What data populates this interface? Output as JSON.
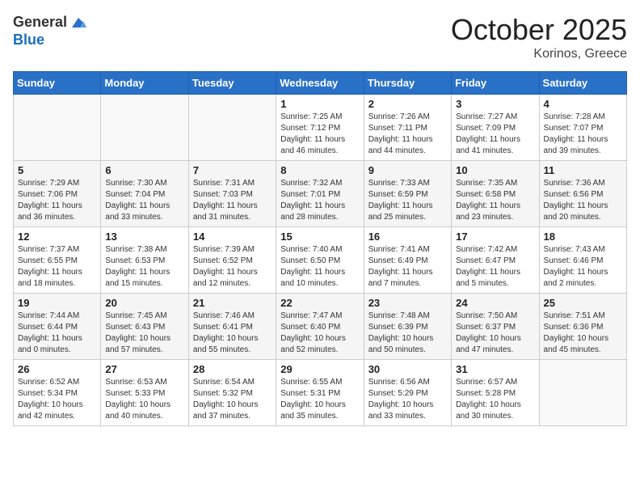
{
  "header": {
    "logo_general": "General",
    "logo_blue": "Blue",
    "month": "October 2025",
    "location": "Korinos, Greece"
  },
  "weekdays": [
    "Sunday",
    "Monday",
    "Tuesday",
    "Wednesday",
    "Thursday",
    "Friday",
    "Saturday"
  ],
  "weeks": [
    [
      {
        "day": "",
        "info": ""
      },
      {
        "day": "",
        "info": ""
      },
      {
        "day": "",
        "info": ""
      },
      {
        "day": "1",
        "info": "Sunrise: 7:25 AM\nSunset: 7:12 PM\nDaylight: 11 hours and 46 minutes."
      },
      {
        "day": "2",
        "info": "Sunrise: 7:26 AM\nSunset: 7:11 PM\nDaylight: 11 hours and 44 minutes."
      },
      {
        "day": "3",
        "info": "Sunrise: 7:27 AM\nSunset: 7:09 PM\nDaylight: 11 hours and 41 minutes."
      },
      {
        "day": "4",
        "info": "Sunrise: 7:28 AM\nSunset: 7:07 PM\nDaylight: 11 hours and 39 minutes."
      }
    ],
    [
      {
        "day": "5",
        "info": "Sunrise: 7:29 AM\nSunset: 7:06 PM\nDaylight: 11 hours and 36 minutes."
      },
      {
        "day": "6",
        "info": "Sunrise: 7:30 AM\nSunset: 7:04 PM\nDaylight: 11 hours and 33 minutes."
      },
      {
        "day": "7",
        "info": "Sunrise: 7:31 AM\nSunset: 7:03 PM\nDaylight: 11 hours and 31 minutes."
      },
      {
        "day": "8",
        "info": "Sunrise: 7:32 AM\nSunset: 7:01 PM\nDaylight: 11 hours and 28 minutes."
      },
      {
        "day": "9",
        "info": "Sunrise: 7:33 AM\nSunset: 6:59 PM\nDaylight: 11 hours and 25 minutes."
      },
      {
        "day": "10",
        "info": "Sunrise: 7:35 AM\nSunset: 6:58 PM\nDaylight: 11 hours and 23 minutes."
      },
      {
        "day": "11",
        "info": "Sunrise: 7:36 AM\nSunset: 6:56 PM\nDaylight: 11 hours and 20 minutes."
      }
    ],
    [
      {
        "day": "12",
        "info": "Sunrise: 7:37 AM\nSunset: 6:55 PM\nDaylight: 11 hours and 18 minutes."
      },
      {
        "day": "13",
        "info": "Sunrise: 7:38 AM\nSunset: 6:53 PM\nDaylight: 11 hours and 15 minutes."
      },
      {
        "day": "14",
        "info": "Sunrise: 7:39 AM\nSunset: 6:52 PM\nDaylight: 11 hours and 12 minutes."
      },
      {
        "day": "15",
        "info": "Sunrise: 7:40 AM\nSunset: 6:50 PM\nDaylight: 11 hours and 10 minutes."
      },
      {
        "day": "16",
        "info": "Sunrise: 7:41 AM\nSunset: 6:49 PM\nDaylight: 11 hours and 7 minutes."
      },
      {
        "day": "17",
        "info": "Sunrise: 7:42 AM\nSunset: 6:47 PM\nDaylight: 11 hours and 5 minutes."
      },
      {
        "day": "18",
        "info": "Sunrise: 7:43 AM\nSunset: 6:46 PM\nDaylight: 11 hours and 2 minutes."
      }
    ],
    [
      {
        "day": "19",
        "info": "Sunrise: 7:44 AM\nSunset: 6:44 PM\nDaylight: 11 hours and 0 minutes."
      },
      {
        "day": "20",
        "info": "Sunrise: 7:45 AM\nSunset: 6:43 PM\nDaylight: 10 hours and 57 minutes."
      },
      {
        "day": "21",
        "info": "Sunrise: 7:46 AM\nSunset: 6:41 PM\nDaylight: 10 hours and 55 minutes."
      },
      {
        "day": "22",
        "info": "Sunrise: 7:47 AM\nSunset: 6:40 PM\nDaylight: 10 hours and 52 minutes."
      },
      {
        "day": "23",
        "info": "Sunrise: 7:48 AM\nSunset: 6:39 PM\nDaylight: 10 hours and 50 minutes."
      },
      {
        "day": "24",
        "info": "Sunrise: 7:50 AM\nSunset: 6:37 PM\nDaylight: 10 hours and 47 minutes."
      },
      {
        "day": "25",
        "info": "Sunrise: 7:51 AM\nSunset: 6:36 PM\nDaylight: 10 hours and 45 minutes."
      }
    ],
    [
      {
        "day": "26",
        "info": "Sunrise: 6:52 AM\nSunset: 5:34 PM\nDaylight: 10 hours and 42 minutes."
      },
      {
        "day": "27",
        "info": "Sunrise: 6:53 AM\nSunset: 5:33 PM\nDaylight: 10 hours and 40 minutes."
      },
      {
        "day": "28",
        "info": "Sunrise: 6:54 AM\nSunset: 5:32 PM\nDaylight: 10 hours and 37 minutes."
      },
      {
        "day": "29",
        "info": "Sunrise: 6:55 AM\nSunset: 5:31 PM\nDaylight: 10 hours and 35 minutes."
      },
      {
        "day": "30",
        "info": "Sunrise: 6:56 AM\nSunset: 5:29 PM\nDaylight: 10 hours and 33 minutes."
      },
      {
        "day": "31",
        "info": "Sunrise: 6:57 AM\nSunset: 5:28 PM\nDaylight: 10 hours and 30 minutes."
      },
      {
        "day": "",
        "info": ""
      }
    ]
  ]
}
